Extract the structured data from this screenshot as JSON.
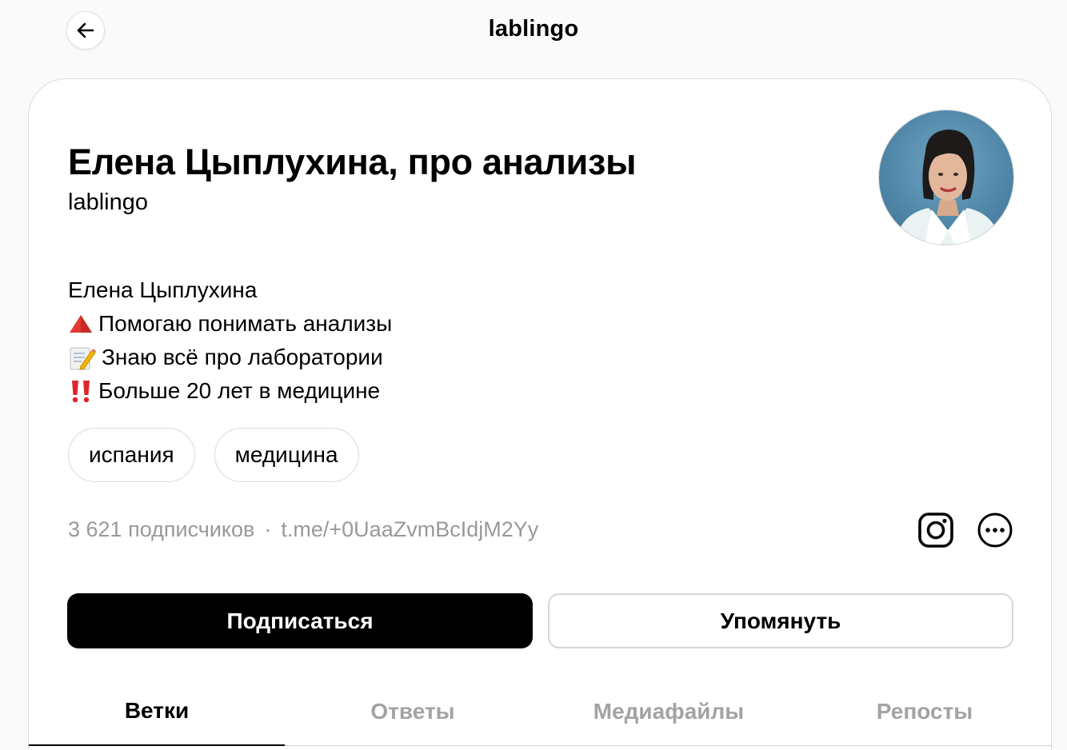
{
  "header": {
    "title": "lablingo",
    "back_icon": "arrow-left-icon"
  },
  "profile": {
    "name": "Елена Цыплухина, про анализы",
    "handle": "lablingo",
    "bio": [
      {
        "emoji": "",
        "text": "Елена Цыплухина"
      },
      {
        "emoji": "red-triangle-icon",
        "text": "Помогаю понимать анализы"
      },
      {
        "emoji": "memo-pencil-icon",
        "text": " Знаю всё про лаборатории"
      },
      {
        "emoji": "double-exclamation-icon",
        "text": "Больше 20 лет в медицине"
      }
    ],
    "tags": [
      "испания",
      "медицина"
    ],
    "followers": "3 621 подписчиков",
    "separator": "·",
    "link": "t.me/+0UaaZvmBcIdjM2Yy"
  },
  "actions": {
    "follow_label": "Подписаться",
    "mention_label": "Упомянуть"
  },
  "tabs": [
    {
      "label": "Ветки",
      "active": true
    },
    {
      "label": "Ответы",
      "active": false
    },
    {
      "label": "Медиафайлы",
      "active": false
    },
    {
      "label": "Репосты",
      "active": false
    }
  ],
  "colors": {
    "accent": "#000000",
    "muted": "#999999",
    "background": "#fafafa"
  }
}
